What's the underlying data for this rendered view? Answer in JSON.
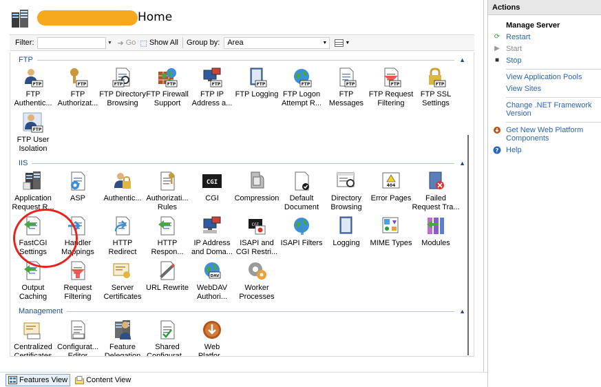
{
  "page": {
    "title": "Home"
  },
  "toolbar": {
    "filter_label": "Filter:",
    "go_label": "Go",
    "show_all_label": "Show All",
    "group_by_label": "Group by:",
    "group_by_value": "Area"
  },
  "sections": {
    "ftp": {
      "name": "FTP",
      "items": [
        {
          "label": "FTP\nAuthentic...",
          "icon": "ftp-authentication-icon"
        },
        {
          "label": "FTP\nAuthorizat...",
          "icon": "ftp-authorization-icon"
        },
        {
          "label": "FTP Directory\nBrowsing",
          "icon": "ftp-directory-browsing-icon"
        },
        {
          "label": "FTP Firewall\nSupport",
          "icon": "ftp-firewall-icon"
        },
        {
          "label": "FTP IP\nAddress a...",
          "icon": "ftp-ip-address-icon"
        },
        {
          "label": "FTP Logging",
          "icon": "ftp-logging-icon"
        },
        {
          "label": "FTP Logon\nAttempt R...",
          "icon": "ftp-logon-attempt-icon"
        },
        {
          "label": "FTP\nMessages",
          "icon": "ftp-messages-icon"
        },
        {
          "label": "FTP Request\nFiltering",
          "icon": "ftp-request-filtering-icon"
        },
        {
          "label": "FTP SSL\nSettings",
          "icon": "ftp-ssl-icon"
        },
        {
          "label": "FTP User\nIsolation",
          "icon": "ftp-user-isolation-icon"
        }
      ]
    },
    "iis": {
      "name": "IIS",
      "items": [
        {
          "label": "Application\nRequest R...",
          "icon": "application-request-routing-icon"
        },
        {
          "label": "ASP",
          "icon": "asp-icon"
        },
        {
          "label": "Authentic...",
          "icon": "authentication-icon"
        },
        {
          "label": "Authorizati...\nRules",
          "icon": "authorization-rules-icon"
        },
        {
          "label": "CGI",
          "icon": "cgi-icon"
        },
        {
          "label": "Compression",
          "icon": "compression-icon"
        },
        {
          "label": "Default\nDocument",
          "icon": "default-document-icon"
        },
        {
          "label": "Directory\nBrowsing",
          "icon": "directory-browsing-icon"
        },
        {
          "label": "Error Pages",
          "icon": "error-pages-icon"
        },
        {
          "label": "Failed\nRequest Tra...",
          "icon": "failed-request-tracing-icon"
        },
        {
          "label": "FastCGI\nSettings",
          "icon": "fastcgi-icon"
        },
        {
          "label": "Handler\nMappings",
          "icon": "handler-mappings-icon"
        },
        {
          "label": "HTTP\nRedirect",
          "icon": "http-redirect-icon"
        },
        {
          "label": "HTTP\nRespon...",
          "icon": "http-response-headers-icon"
        },
        {
          "label": "IP Address\nand Doma...",
          "icon": "ip-address-domain-icon"
        },
        {
          "label": "ISAPI and\nCGI Restri...",
          "icon": "isapi-cgi-restrictions-icon"
        },
        {
          "label": "ISAPI Filters",
          "icon": "isapi-filters-icon"
        },
        {
          "label": "Logging",
          "icon": "logging-icon"
        },
        {
          "label": "MIME Types",
          "icon": "mime-types-icon"
        },
        {
          "label": "Modules",
          "icon": "modules-icon"
        },
        {
          "label": "Output\nCaching",
          "icon": "output-caching-icon"
        },
        {
          "label": "Request\nFiltering",
          "icon": "request-filtering-icon"
        },
        {
          "label": "Server\nCertificates",
          "icon": "server-certificates-icon"
        },
        {
          "label": "URL Rewrite",
          "icon": "url-rewrite-icon"
        },
        {
          "label": "WebDAV\nAuthori...",
          "icon": "webdav-icon"
        },
        {
          "label": "Worker\nProcesses",
          "icon": "worker-processes-icon"
        }
      ]
    },
    "management": {
      "name": "Management",
      "items": [
        {
          "label": "Centralized\nCertificates",
          "icon": "centralized-certificates-icon"
        },
        {
          "label": "Configurat...\nEditor",
          "icon": "configuration-editor-icon"
        },
        {
          "label": "Feature\nDelegation",
          "icon": "feature-delegation-icon"
        },
        {
          "label": "Shared\nConfigurat...",
          "icon": "shared-configuration-icon"
        },
        {
          "label": "Web\nPlatfor...",
          "icon": "web-platform-installer-icon"
        }
      ]
    }
  },
  "bottom_tabs": {
    "features_view": "Features View",
    "content_view": "Content View"
  },
  "actions": {
    "header": "Actions",
    "manage_server": "Manage Server",
    "restart": "Restart",
    "start": "Start",
    "stop": "Stop",
    "view_app_pools": "View Application Pools",
    "view_sites": "View Sites",
    "change_net_line1": "Change .NET Framework",
    "change_net_line2": "Version",
    "get_wpc_line1": "Get New Web Platform",
    "get_wpc_line2": "Components",
    "help": "Help"
  },
  "colors": {
    "link": "#2965b8",
    "section_header": "#1e4e8c",
    "highlight_circle": "#e8221d",
    "redaction": "#f6a91c"
  }
}
